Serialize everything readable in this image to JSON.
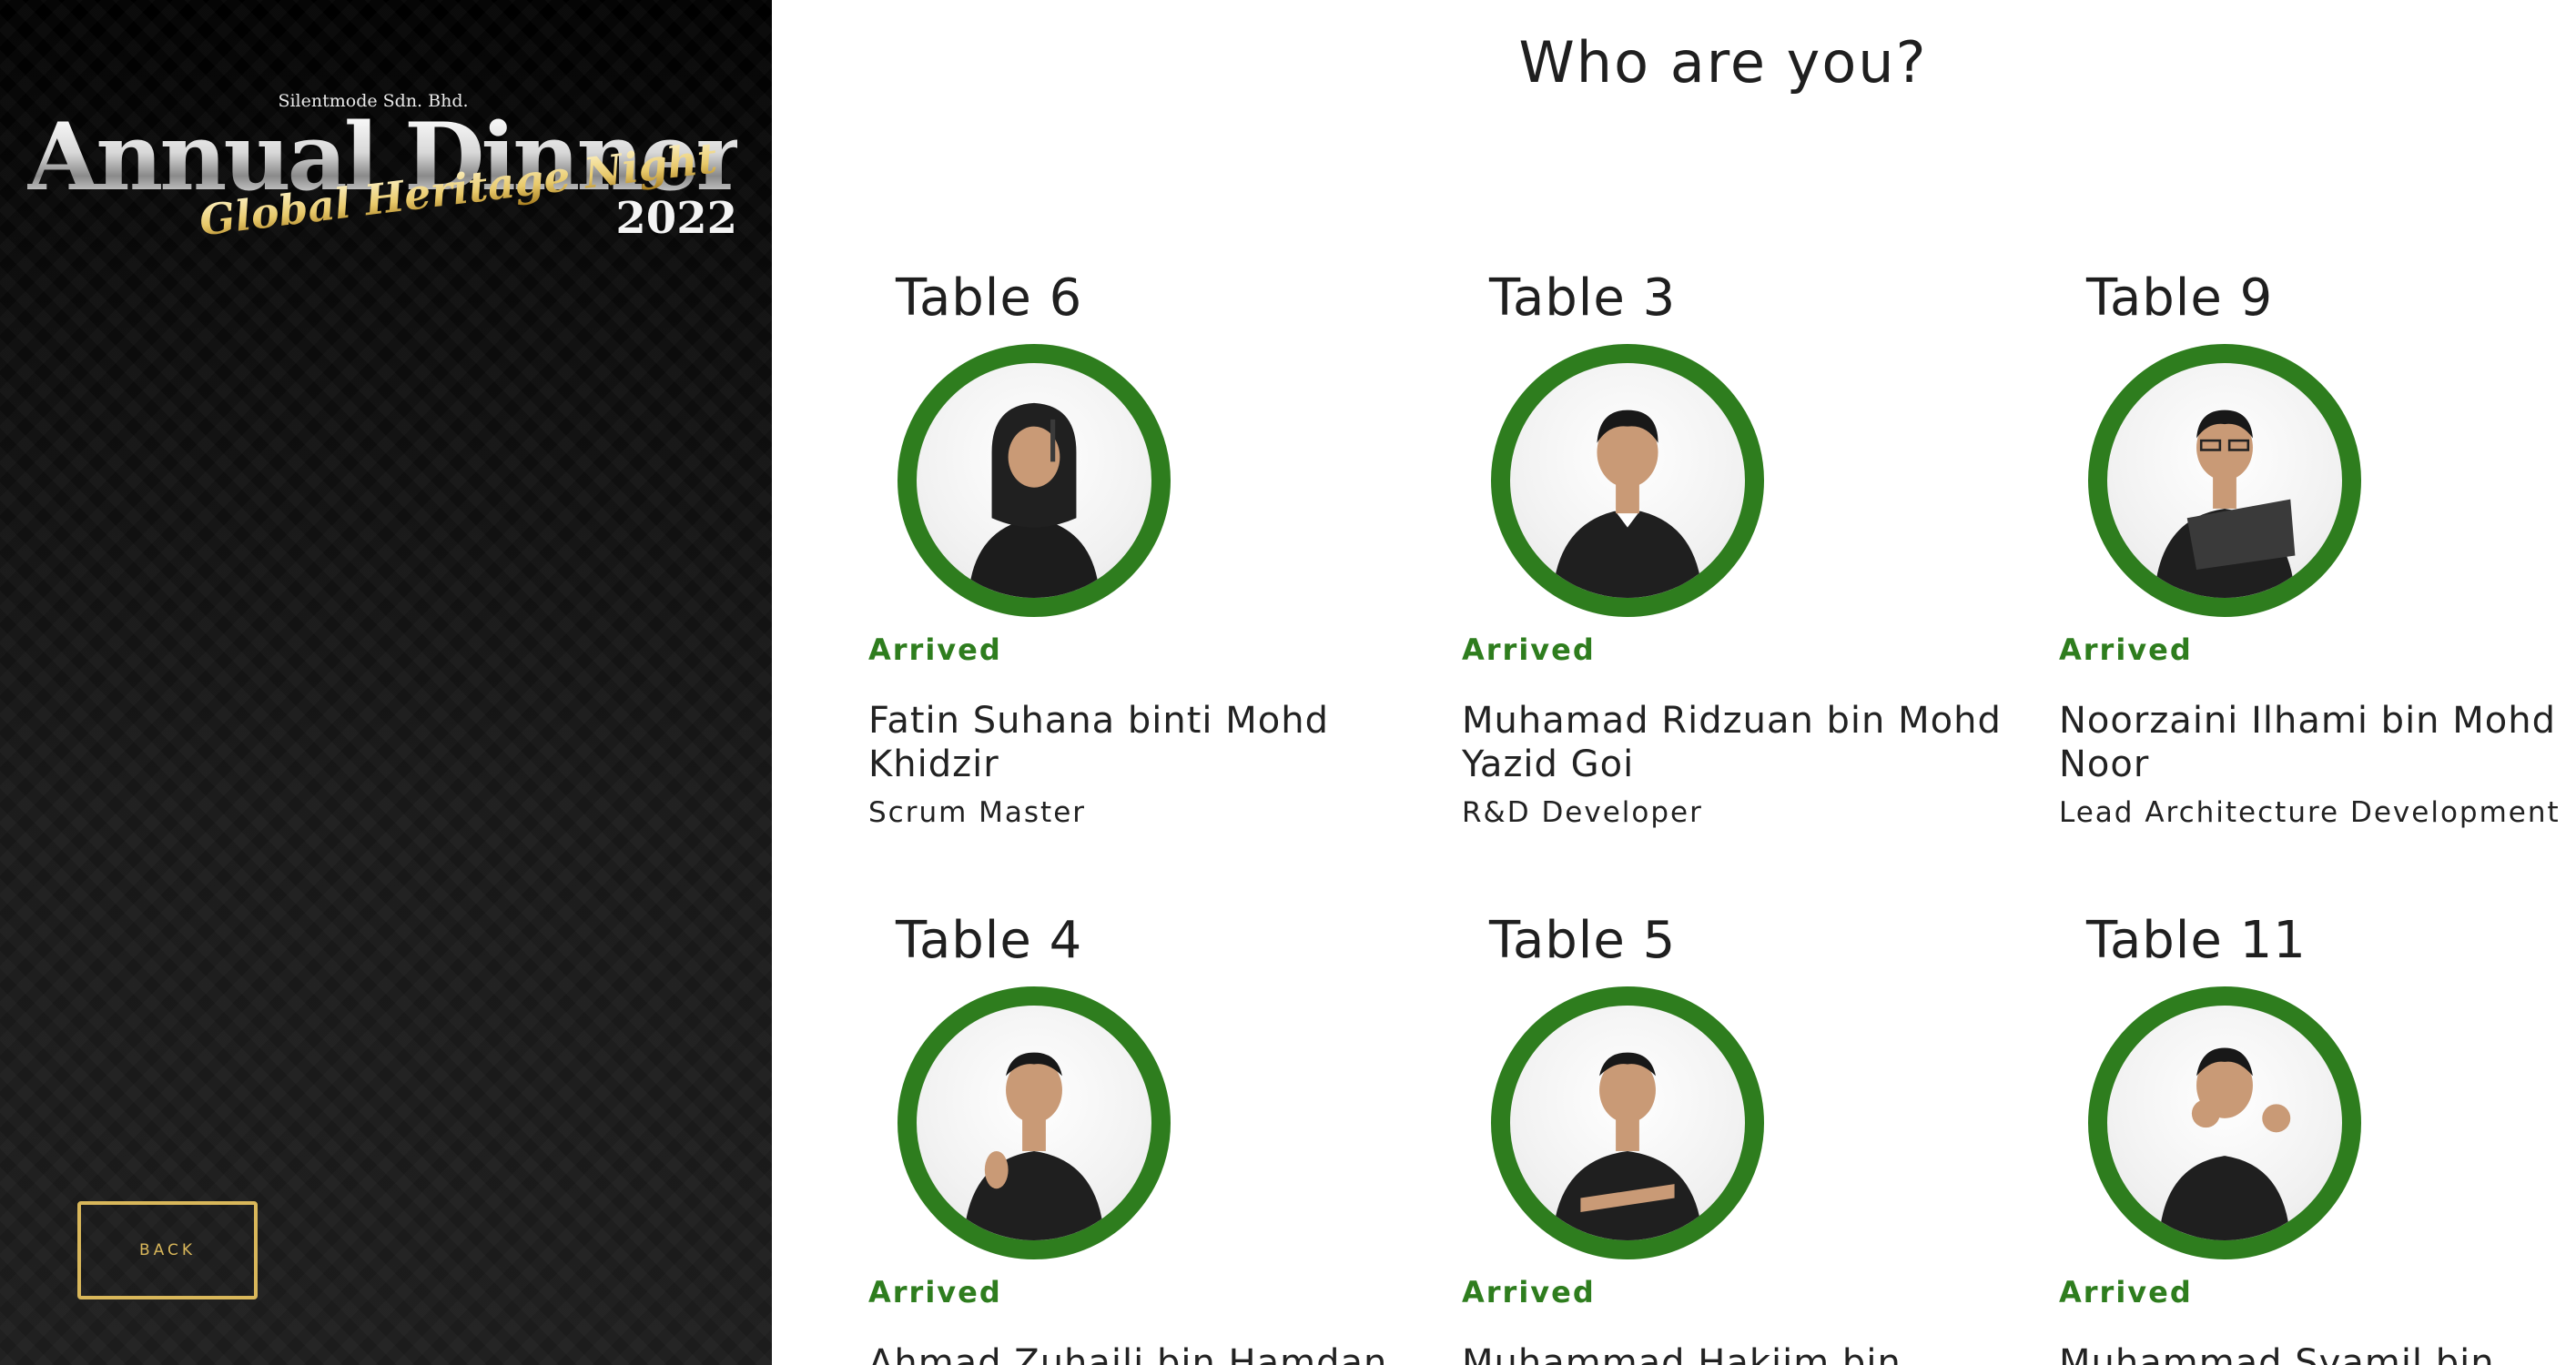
{
  "sidebar": {
    "logo": {
      "company": "Silentmode Sdn. Bhd.",
      "title": "Annual Dinner",
      "subtitle": "Global Heritage Night",
      "year": "2022"
    },
    "back_label": "BACK"
  },
  "main": {
    "title": "Who are you?",
    "cards": [
      {
        "table": "Table 6",
        "status": "Arrived",
        "name": "Fatin Suhana binti Mohd Khidzir",
        "role": "Scrum Master"
      },
      {
        "table": "Table 3",
        "status": "Arrived",
        "name": "Muhamad Ridzuan bin Mohd Yazid Goi",
        "role": "R&D Developer"
      },
      {
        "table": "Table 9",
        "status": "Arrived",
        "name": "Noorzaini Ilhami bin Mohd Noor",
        "role": "Lead Architecture Development"
      },
      {
        "table": "Table 4",
        "status": "Arrived",
        "name": "Ahmad Zuhaili bin Hamdan",
        "role": ""
      },
      {
        "table": "Table 5",
        "status": "Arrived",
        "name": "Muhammad Hakiim bin",
        "role": ""
      },
      {
        "table": "Table 11",
        "status": "Arrived",
        "name": "Muhammad Syamil bin",
        "role": ""
      }
    ]
  },
  "colors": {
    "accent_green": "#2e7d1e",
    "gold": "#d9b75a"
  }
}
